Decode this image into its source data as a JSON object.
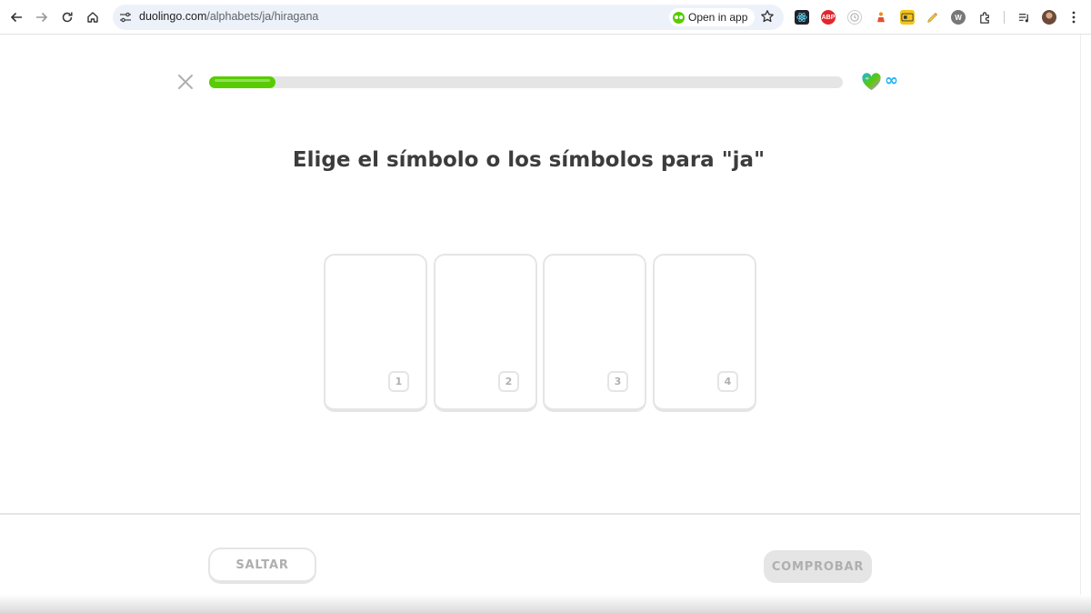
{
  "browser": {
    "url_host": "duolingo.com",
    "url_path": "/alphabets/ja/hiragana",
    "open_in_app_label": "Open in app",
    "extensions": [
      "react-devtools-icon",
      "adblock-icon",
      "extension-clock-icon",
      "extension-figure-icon",
      "extension-card-icon",
      "extension-pencil-icon",
      "extension-w-icon",
      "puzzle-icon"
    ],
    "extension_labels": {
      "adblock": "ABP",
      "w": "W"
    }
  },
  "lesson": {
    "progress": 0.105,
    "lives": "∞",
    "prompt": "Elige el símbolo o los símbolos para \"ja\"",
    "choices": [
      {
        "number": "1"
      },
      {
        "number": "2"
      },
      {
        "number": "3"
      },
      {
        "number": "4"
      }
    ],
    "skip_label": "SALTAR",
    "check_label": "COMPROBAR"
  },
  "colors": {
    "progress_green": "#58cc02",
    "track_gray": "#e5e5e5",
    "text_dark": "#3c3c3c",
    "disabled_text": "#afafaf",
    "infinity_blue": "#1cb0f6"
  }
}
